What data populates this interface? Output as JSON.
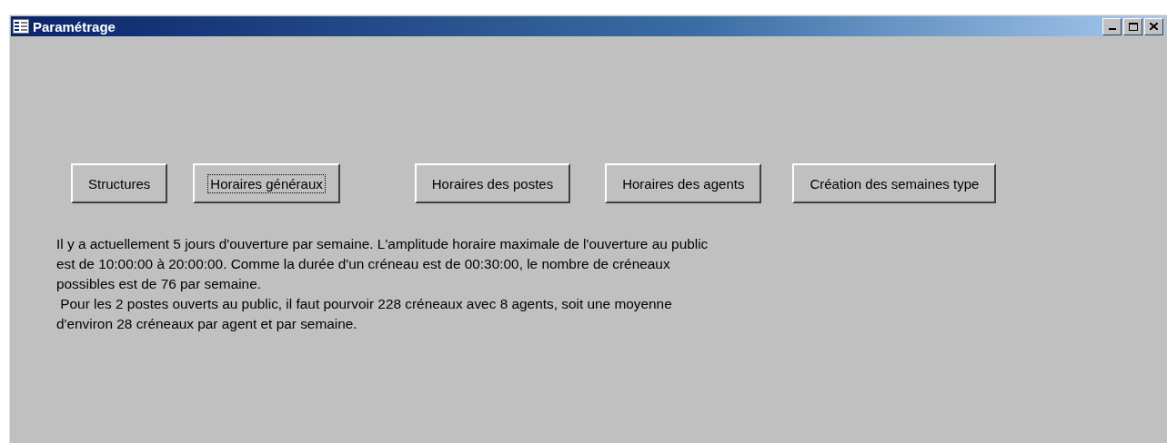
{
  "window": {
    "title": "Paramétrage"
  },
  "buttons": [
    {
      "label": "Structures",
      "focused": false
    },
    {
      "label": "Horaires généraux",
      "focused": true
    },
    {
      "label": "Horaires des postes",
      "focused": false
    },
    {
      "label": "Horaires des agents",
      "focused": false
    },
    {
      "label": "Création des semaines type",
      "focused": false
    }
  ],
  "info_paragraphs": [
    {
      "lines": [
        "Il y a actuellement 5 jours d'ouverture par semaine. L'amplitude horaire maximale de l'ouverture au public",
        "est de 10:00:00 à 20:00:00. Comme la durée d'un créneau est de 00:30:00, le nombre de créneaux",
        "possibles est de 76 par semaine."
      ]
    },
    {
      "lines": [
        " Pour les 2 postes ouverts au public, il faut pourvoir 228 créneaux avec 8 agents, soit une moyenne",
        "d'environ 28 créneaux par agent et par semaine."
      ]
    }
  ]
}
